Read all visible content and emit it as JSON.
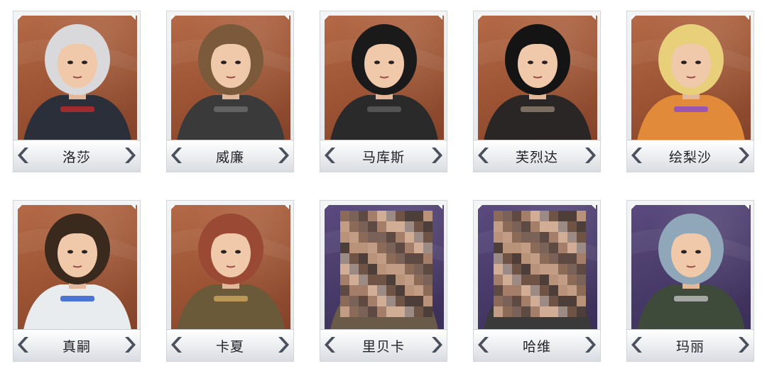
{
  "characters": [
    {
      "name": "洛莎",
      "bg": "orange",
      "hair": "#d9d9dc",
      "accent": "#b42a2a",
      "outfit": "#2b2f3a",
      "pixelated": false
    },
    {
      "name": "威廉",
      "bg": "orange",
      "hair": "#7a5a3a",
      "accent": "#6b6b6b",
      "outfit": "#3a3a3a",
      "pixelated": false
    },
    {
      "name": "马库斯",
      "bg": "orange",
      "hair": "#1a1a1a",
      "accent": "#5a5a5a",
      "outfit": "#2a2a2a",
      "pixelated": false
    },
    {
      "name": "芙烈达",
      "bg": "orange",
      "hair": "#141414",
      "accent": "#8a7a6a",
      "outfit": "#2a2626",
      "pixelated": false
    },
    {
      "name": "绘梨沙",
      "bg": "orange",
      "hair": "#e8cf7a",
      "accent": "#8f4cc4",
      "outfit": "#e08a3a",
      "pixelated": false
    },
    {
      "name": "真嗣",
      "bg": "orange",
      "hair": "#3a2a1e",
      "accent": "#2f5fcf",
      "outfit": "#e8ecef",
      "pixelated": false
    },
    {
      "name": "卡夏",
      "bg": "orange",
      "hair": "#9a4a34",
      "accent": "#c9a25a",
      "outfit": "#6b5a3a",
      "pixelated": false
    },
    {
      "name": "里贝卡",
      "bg": "purple",
      "hair": "#9aa0ac",
      "accent": "#c29a4a",
      "outfit": "#6a5a48",
      "pixelated": true
    },
    {
      "name": "哈维",
      "bg": "purple",
      "hair": "#5a4a40",
      "accent": "#7a6a62",
      "outfit": "#3a3a3a",
      "pixelated": true
    },
    {
      "name": "玛丽",
      "bg": "purple",
      "hair": "#8fa7b8",
      "accent": "#b8b8b8",
      "outfit": "#3e4a3a",
      "pixelated": false
    }
  ]
}
